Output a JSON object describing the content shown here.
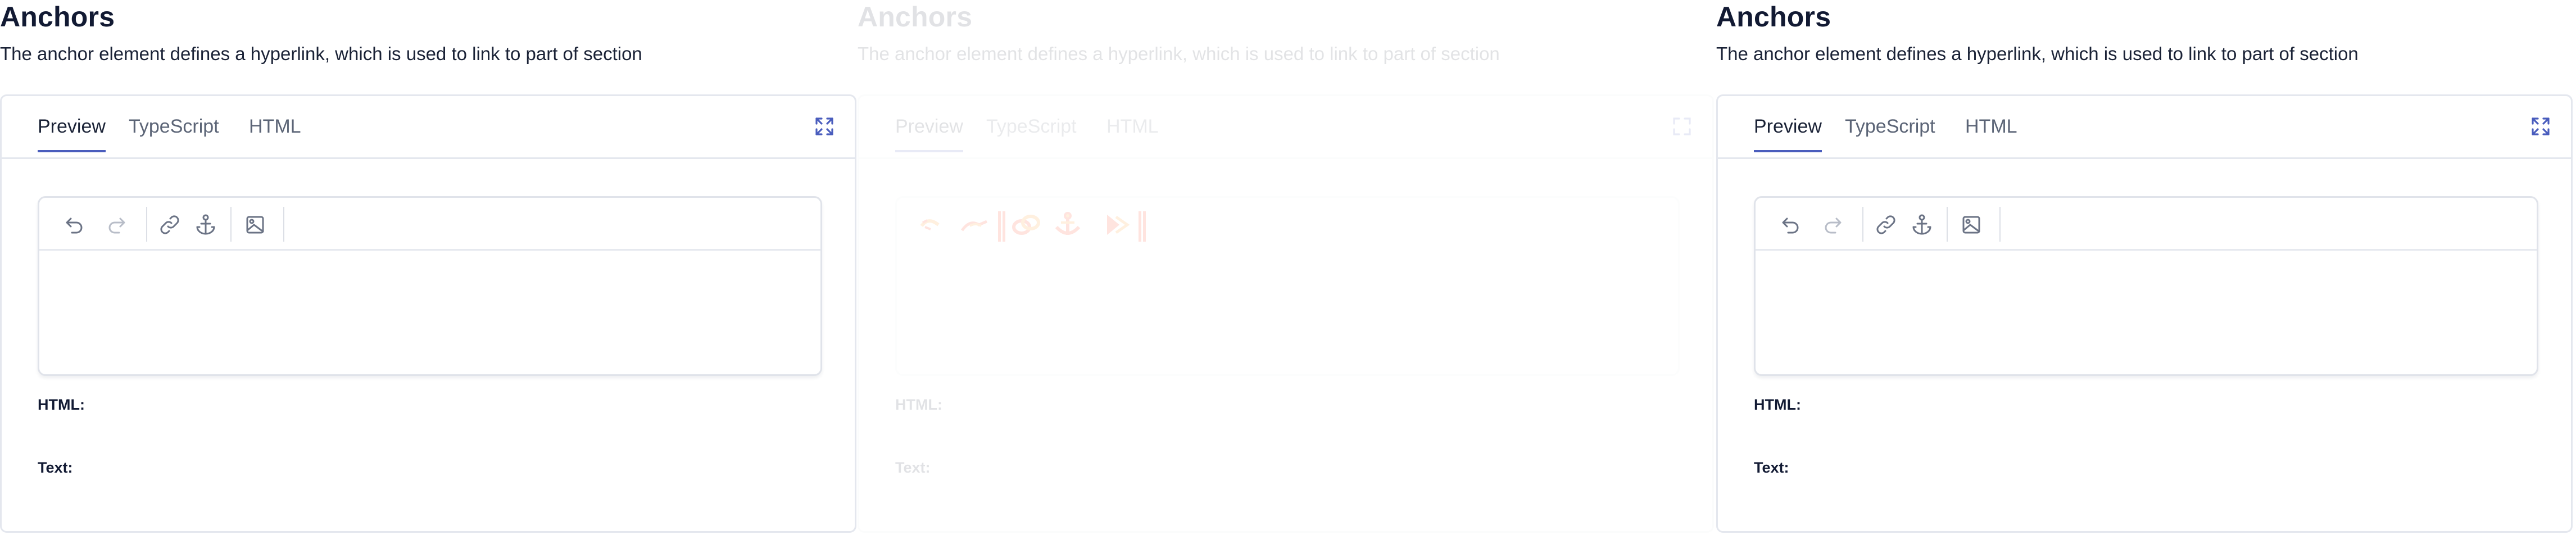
{
  "panels": [
    {
      "title": "Anchors",
      "description": "The anchor element defines a hyperlink, which is used to link to part of section",
      "tabs": [
        "Preview",
        "TypeScript",
        "HTML"
      ],
      "active_tab": "Preview",
      "toolbar_icons": [
        "undo-icon",
        "redo-icon",
        "link-icon",
        "anchor-icon",
        "image-icon"
      ],
      "html_label": "HTML:",
      "html_value": "",
      "text_label": "Text:",
      "text_value": ""
    },
    {
      "title": "Anchors",
      "description": "The anchor element defines a hyperlink, which is used to link to part of section",
      "tabs": [
        "Preview",
        "TypeScript",
        "HTML"
      ],
      "active_tab": "Preview",
      "html_label": "HTML:",
      "html_value": "",
      "text_label": "Text:",
      "text_value": ""
    },
    {
      "title": "Anchors",
      "description": "The anchor element defines a hyperlink, which is used to link to part of section",
      "tabs": [
        "Preview",
        "TypeScript",
        "HTML"
      ],
      "active_tab": "Preview",
      "toolbar_icons": [
        "undo-icon",
        "redo-icon",
        "link-icon",
        "anchor-icon",
        "image-icon"
      ],
      "html_label": "HTML:",
      "html_value": "",
      "text_label": "Text:",
      "text_value": ""
    }
  ],
  "colors": {
    "accent": "#4a5dbd",
    "title": "#121a33",
    "muted_text": "#5b6476",
    "border": "#e4e7ee",
    "icon_inactive": "#9aa1b0",
    "icon_active": "#6b7385",
    "broken_glyph_orange": "#ff8c00",
    "broken_glyph_red": "#ff2a00"
  }
}
